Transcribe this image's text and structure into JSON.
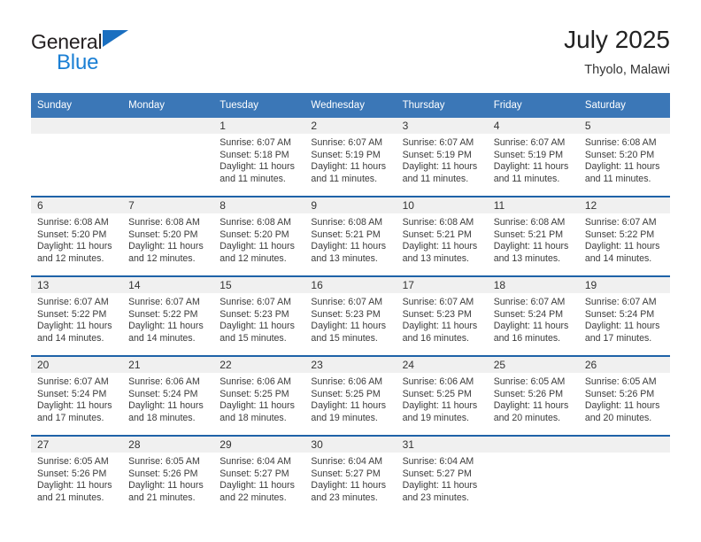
{
  "brand": {
    "line1": "General",
    "line2": "Blue",
    "triangle_icon": "triangle-icon",
    "color_text": "#231f20",
    "color_blue": "#1a7fd4"
  },
  "header": {
    "title": "July 2025",
    "subtitle": "Thyolo, Malawi"
  },
  "theme": {
    "header_blue": "#3b77b7",
    "row_separator_blue": "#1f63a8",
    "daynum_band": "#f0f0f0"
  },
  "calendar": {
    "weekday_headers": [
      "Sunday",
      "Monday",
      "Tuesday",
      "Wednesday",
      "Thursday",
      "Friday",
      "Saturday"
    ],
    "weeks": [
      [
        {
          "day": "",
          "sunrise": "",
          "sunset": "",
          "daylight": ""
        },
        {
          "day": "",
          "sunrise": "",
          "sunset": "",
          "daylight": ""
        },
        {
          "day": "1",
          "sunrise": "Sunrise: 6:07 AM",
          "sunset": "Sunset: 5:18 PM",
          "daylight": "Daylight: 11 hours and 11 minutes."
        },
        {
          "day": "2",
          "sunrise": "Sunrise: 6:07 AM",
          "sunset": "Sunset: 5:19 PM",
          "daylight": "Daylight: 11 hours and 11 minutes."
        },
        {
          "day": "3",
          "sunrise": "Sunrise: 6:07 AM",
          "sunset": "Sunset: 5:19 PM",
          "daylight": "Daylight: 11 hours and 11 minutes."
        },
        {
          "day": "4",
          "sunrise": "Sunrise: 6:07 AM",
          "sunset": "Sunset: 5:19 PM",
          "daylight": "Daylight: 11 hours and 11 minutes."
        },
        {
          "day": "5",
          "sunrise": "Sunrise: 6:08 AM",
          "sunset": "Sunset: 5:20 PM",
          "daylight": "Daylight: 11 hours and 11 minutes."
        }
      ],
      [
        {
          "day": "6",
          "sunrise": "Sunrise: 6:08 AM",
          "sunset": "Sunset: 5:20 PM",
          "daylight": "Daylight: 11 hours and 12 minutes."
        },
        {
          "day": "7",
          "sunrise": "Sunrise: 6:08 AM",
          "sunset": "Sunset: 5:20 PM",
          "daylight": "Daylight: 11 hours and 12 minutes."
        },
        {
          "day": "8",
          "sunrise": "Sunrise: 6:08 AM",
          "sunset": "Sunset: 5:20 PM",
          "daylight": "Daylight: 11 hours and 12 minutes."
        },
        {
          "day": "9",
          "sunrise": "Sunrise: 6:08 AM",
          "sunset": "Sunset: 5:21 PM",
          "daylight": "Daylight: 11 hours and 13 minutes."
        },
        {
          "day": "10",
          "sunrise": "Sunrise: 6:08 AM",
          "sunset": "Sunset: 5:21 PM",
          "daylight": "Daylight: 11 hours and 13 minutes."
        },
        {
          "day": "11",
          "sunrise": "Sunrise: 6:08 AM",
          "sunset": "Sunset: 5:21 PM",
          "daylight": "Daylight: 11 hours and 13 minutes."
        },
        {
          "day": "12",
          "sunrise": "Sunrise: 6:07 AM",
          "sunset": "Sunset: 5:22 PM",
          "daylight": "Daylight: 11 hours and 14 minutes."
        }
      ],
      [
        {
          "day": "13",
          "sunrise": "Sunrise: 6:07 AM",
          "sunset": "Sunset: 5:22 PM",
          "daylight": "Daylight: 11 hours and 14 minutes."
        },
        {
          "day": "14",
          "sunrise": "Sunrise: 6:07 AM",
          "sunset": "Sunset: 5:22 PM",
          "daylight": "Daylight: 11 hours and 14 minutes."
        },
        {
          "day": "15",
          "sunrise": "Sunrise: 6:07 AM",
          "sunset": "Sunset: 5:23 PM",
          "daylight": "Daylight: 11 hours and 15 minutes."
        },
        {
          "day": "16",
          "sunrise": "Sunrise: 6:07 AM",
          "sunset": "Sunset: 5:23 PM",
          "daylight": "Daylight: 11 hours and 15 minutes."
        },
        {
          "day": "17",
          "sunrise": "Sunrise: 6:07 AM",
          "sunset": "Sunset: 5:23 PM",
          "daylight": "Daylight: 11 hours and 16 minutes."
        },
        {
          "day": "18",
          "sunrise": "Sunrise: 6:07 AM",
          "sunset": "Sunset: 5:24 PM",
          "daylight": "Daylight: 11 hours and 16 minutes."
        },
        {
          "day": "19",
          "sunrise": "Sunrise: 6:07 AM",
          "sunset": "Sunset: 5:24 PM",
          "daylight": "Daylight: 11 hours and 17 minutes."
        }
      ],
      [
        {
          "day": "20",
          "sunrise": "Sunrise: 6:07 AM",
          "sunset": "Sunset: 5:24 PM",
          "daylight": "Daylight: 11 hours and 17 minutes."
        },
        {
          "day": "21",
          "sunrise": "Sunrise: 6:06 AM",
          "sunset": "Sunset: 5:24 PM",
          "daylight": "Daylight: 11 hours and 18 minutes."
        },
        {
          "day": "22",
          "sunrise": "Sunrise: 6:06 AM",
          "sunset": "Sunset: 5:25 PM",
          "daylight": "Daylight: 11 hours and 18 minutes."
        },
        {
          "day": "23",
          "sunrise": "Sunrise: 6:06 AM",
          "sunset": "Sunset: 5:25 PM",
          "daylight": "Daylight: 11 hours and 19 minutes."
        },
        {
          "day": "24",
          "sunrise": "Sunrise: 6:06 AM",
          "sunset": "Sunset: 5:25 PM",
          "daylight": "Daylight: 11 hours and 19 minutes."
        },
        {
          "day": "25",
          "sunrise": "Sunrise: 6:05 AM",
          "sunset": "Sunset: 5:26 PM",
          "daylight": "Daylight: 11 hours and 20 minutes."
        },
        {
          "day": "26",
          "sunrise": "Sunrise: 6:05 AM",
          "sunset": "Sunset: 5:26 PM",
          "daylight": "Daylight: 11 hours and 20 minutes."
        }
      ],
      [
        {
          "day": "27",
          "sunrise": "Sunrise: 6:05 AM",
          "sunset": "Sunset: 5:26 PM",
          "daylight": "Daylight: 11 hours and 21 minutes."
        },
        {
          "day": "28",
          "sunrise": "Sunrise: 6:05 AM",
          "sunset": "Sunset: 5:26 PM",
          "daylight": "Daylight: 11 hours and 21 minutes."
        },
        {
          "day": "29",
          "sunrise": "Sunrise: 6:04 AM",
          "sunset": "Sunset: 5:27 PM",
          "daylight": "Daylight: 11 hours and 22 minutes."
        },
        {
          "day": "30",
          "sunrise": "Sunrise: 6:04 AM",
          "sunset": "Sunset: 5:27 PM",
          "daylight": "Daylight: 11 hours and 23 minutes."
        },
        {
          "day": "31",
          "sunrise": "Sunrise: 6:04 AM",
          "sunset": "Sunset: 5:27 PM",
          "daylight": "Daylight: 11 hours and 23 minutes."
        },
        {
          "day": "",
          "sunrise": "",
          "sunset": "",
          "daylight": ""
        },
        {
          "day": "",
          "sunrise": "",
          "sunset": "",
          "daylight": ""
        }
      ]
    ]
  }
}
